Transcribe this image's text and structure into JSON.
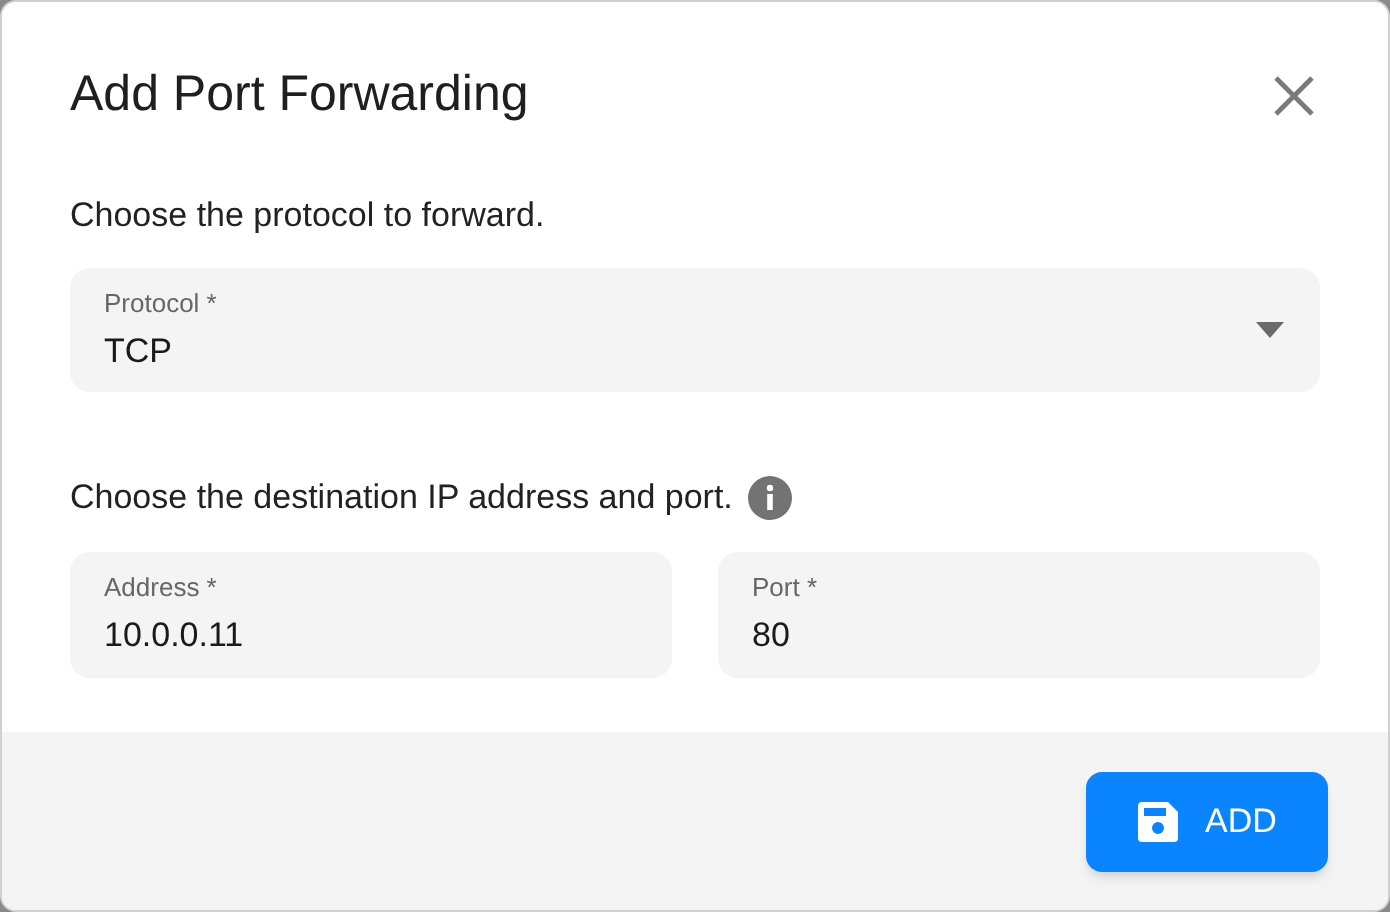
{
  "dialog": {
    "title": "Add Port Forwarding"
  },
  "protocol_section": {
    "text": "Choose the protocol to forward.",
    "select": {
      "label": "Protocol *",
      "value": "TCP"
    }
  },
  "destination_section": {
    "text": "Choose the destination IP address and port.",
    "fields": [
      {
        "label": "Address *",
        "value": "10.0.0.11"
      },
      {
        "label": "Port *",
        "value": "80"
      }
    ]
  },
  "buttons": [
    {
      "label": "ADD"
    }
  ]
}
